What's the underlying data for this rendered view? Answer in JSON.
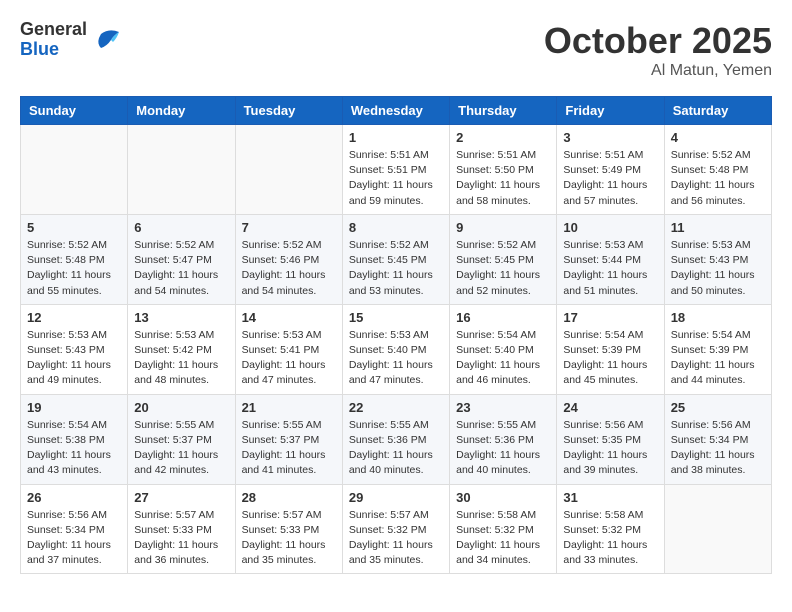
{
  "header": {
    "logo_general": "General",
    "logo_blue": "Blue",
    "month_title": "October 2025",
    "location": "Al Matun, Yemen"
  },
  "days_of_week": [
    "Sunday",
    "Monday",
    "Tuesday",
    "Wednesday",
    "Thursday",
    "Friday",
    "Saturday"
  ],
  "weeks": [
    [
      {
        "day": "",
        "info": ""
      },
      {
        "day": "",
        "info": ""
      },
      {
        "day": "",
        "info": ""
      },
      {
        "day": "1",
        "info": "Sunrise: 5:51 AM\nSunset: 5:51 PM\nDaylight: 11 hours and 59 minutes."
      },
      {
        "day": "2",
        "info": "Sunrise: 5:51 AM\nSunset: 5:50 PM\nDaylight: 11 hours and 58 minutes."
      },
      {
        "day": "3",
        "info": "Sunrise: 5:51 AM\nSunset: 5:49 PM\nDaylight: 11 hours and 57 minutes."
      },
      {
        "day": "4",
        "info": "Sunrise: 5:52 AM\nSunset: 5:48 PM\nDaylight: 11 hours and 56 minutes."
      }
    ],
    [
      {
        "day": "5",
        "info": "Sunrise: 5:52 AM\nSunset: 5:48 PM\nDaylight: 11 hours and 55 minutes."
      },
      {
        "day": "6",
        "info": "Sunrise: 5:52 AM\nSunset: 5:47 PM\nDaylight: 11 hours and 54 minutes."
      },
      {
        "day": "7",
        "info": "Sunrise: 5:52 AM\nSunset: 5:46 PM\nDaylight: 11 hours and 54 minutes."
      },
      {
        "day": "8",
        "info": "Sunrise: 5:52 AM\nSunset: 5:45 PM\nDaylight: 11 hours and 53 minutes."
      },
      {
        "day": "9",
        "info": "Sunrise: 5:52 AM\nSunset: 5:45 PM\nDaylight: 11 hours and 52 minutes."
      },
      {
        "day": "10",
        "info": "Sunrise: 5:53 AM\nSunset: 5:44 PM\nDaylight: 11 hours and 51 minutes."
      },
      {
        "day": "11",
        "info": "Sunrise: 5:53 AM\nSunset: 5:43 PM\nDaylight: 11 hours and 50 minutes."
      }
    ],
    [
      {
        "day": "12",
        "info": "Sunrise: 5:53 AM\nSunset: 5:43 PM\nDaylight: 11 hours and 49 minutes."
      },
      {
        "day": "13",
        "info": "Sunrise: 5:53 AM\nSunset: 5:42 PM\nDaylight: 11 hours and 48 minutes."
      },
      {
        "day": "14",
        "info": "Sunrise: 5:53 AM\nSunset: 5:41 PM\nDaylight: 11 hours and 47 minutes."
      },
      {
        "day": "15",
        "info": "Sunrise: 5:53 AM\nSunset: 5:40 PM\nDaylight: 11 hours and 47 minutes."
      },
      {
        "day": "16",
        "info": "Sunrise: 5:54 AM\nSunset: 5:40 PM\nDaylight: 11 hours and 46 minutes."
      },
      {
        "day": "17",
        "info": "Sunrise: 5:54 AM\nSunset: 5:39 PM\nDaylight: 11 hours and 45 minutes."
      },
      {
        "day": "18",
        "info": "Sunrise: 5:54 AM\nSunset: 5:39 PM\nDaylight: 11 hours and 44 minutes."
      }
    ],
    [
      {
        "day": "19",
        "info": "Sunrise: 5:54 AM\nSunset: 5:38 PM\nDaylight: 11 hours and 43 minutes."
      },
      {
        "day": "20",
        "info": "Sunrise: 5:55 AM\nSunset: 5:37 PM\nDaylight: 11 hours and 42 minutes."
      },
      {
        "day": "21",
        "info": "Sunrise: 5:55 AM\nSunset: 5:37 PM\nDaylight: 11 hours and 41 minutes."
      },
      {
        "day": "22",
        "info": "Sunrise: 5:55 AM\nSunset: 5:36 PM\nDaylight: 11 hours and 40 minutes."
      },
      {
        "day": "23",
        "info": "Sunrise: 5:55 AM\nSunset: 5:36 PM\nDaylight: 11 hours and 40 minutes."
      },
      {
        "day": "24",
        "info": "Sunrise: 5:56 AM\nSunset: 5:35 PM\nDaylight: 11 hours and 39 minutes."
      },
      {
        "day": "25",
        "info": "Sunrise: 5:56 AM\nSunset: 5:34 PM\nDaylight: 11 hours and 38 minutes."
      }
    ],
    [
      {
        "day": "26",
        "info": "Sunrise: 5:56 AM\nSunset: 5:34 PM\nDaylight: 11 hours and 37 minutes."
      },
      {
        "day": "27",
        "info": "Sunrise: 5:57 AM\nSunset: 5:33 PM\nDaylight: 11 hours and 36 minutes."
      },
      {
        "day": "28",
        "info": "Sunrise: 5:57 AM\nSunset: 5:33 PM\nDaylight: 11 hours and 35 minutes."
      },
      {
        "day": "29",
        "info": "Sunrise: 5:57 AM\nSunset: 5:32 PM\nDaylight: 11 hours and 35 minutes."
      },
      {
        "day": "30",
        "info": "Sunrise: 5:58 AM\nSunset: 5:32 PM\nDaylight: 11 hours and 34 minutes."
      },
      {
        "day": "31",
        "info": "Sunrise: 5:58 AM\nSunset: 5:32 PM\nDaylight: 11 hours and 33 minutes."
      },
      {
        "day": "",
        "info": ""
      }
    ]
  ]
}
